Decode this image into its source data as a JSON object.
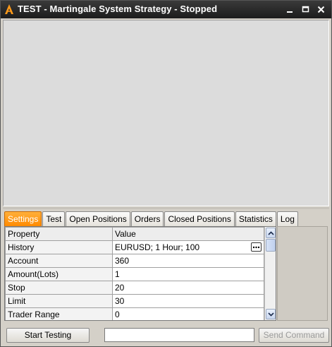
{
  "window": {
    "title": "TEST - Martingale System Strategy - Stopped",
    "app_icon": "app-logo-icon",
    "controls": [
      "minimize-icon",
      "maximize-icon",
      "close-icon"
    ]
  },
  "tabs": [
    {
      "label": "Settings",
      "active": true
    },
    {
      "label": "Test",
      "active": false
    },
    {
      "label": "Open Positions",
      "active": false
    },
    {
      "label": "Orders",
      "active": false
    },
    {
      "label": "Closed Positions",
      "active": false
    },
    {
      "label": "Statistics",
      "active": false
    },
    {
      "label": "Log",
      "active": false
    }
  ],
  "grid": {
    "columns": [
      "Property",
      "Value"
    ],
    "rows": [
      {
        "property": "History",
        "value": "EURUSD; 1 Hour; 100"
      },
      {
        "property": "Account",
        "value": "360"
      },
      {
        "property": "Amount(Lots)",
        "value": "1"
      },
      {
        "property": "Stop",
        "value": "20"
      },
      {
        "property": "Limit",
        "value": "30"
      },
      {
        "property": "Trader Range",
        "value": "0"
      }
    ]
  },
  "footer": {
    "start_label": "Start Testing",
    "command_value": "",
    "send_label": "Send Command"
  },
  "colors": {
    "active_tab": "#ff8a00",
    "titlebar": "#1c1c1c",
    "app_icon": "#ff9a1a"
  }
}
